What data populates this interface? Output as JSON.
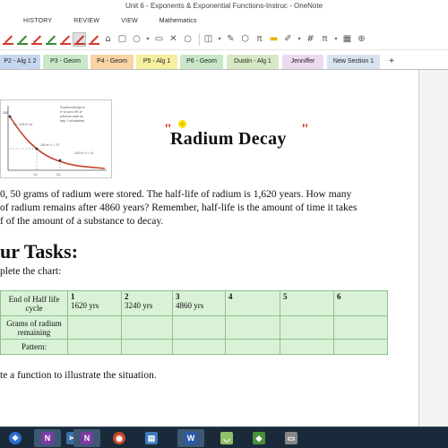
{
  "window": {
    "title": "Unit 6 - Exponents & Exponential Functions-Instruc - OneNote"
  },
  "ribbon": {
    "tabs": [
      "HISTORY",
      "REVIEW",
      "VIEW",
      "Mathematics"
    ],
    "active": "Mathematics"
  },
  "toolbar": {
    "pen_colors": [
      "#d63a2a",
      "#3a8a3a",
      "#d63a2a",
      "#3a8a3a",
      "#d63a2a",
      "#c0392b",
      "#d63a2a"
    ],
    "selected_tool_index": 5,
    "icons": [
      "lasso-icon",
      "shapes-icon",
      "eraser-icon",
      "circle-icon",
      "insert-space-icon",
      "ink-to-math-icon",
      "pi-icon",
      "highlight-icon",
      "pen-dropdown-icon",
      "grid-icon",
      "math-pi-icon",
      "table-icon",
      "more-icon"
    ],
    "glyphs": {
      "pi": "π",
      "grid": "#",
      "close": "✕",
      "plus": "+"
    }
  },
  "sections": [
    {
      "label": "P2 - Alg 1 2",
      "color": "#c8d7f0"
    },
    {
      "label": "P3 - Geom",
      "color": "#c9e8c9"
    },
    {
      "label": "P4 - Geom",
      "color": "#f7d3a6"
    },
    {
      "label": "P5 - Alg 1",
      "color": "#f5efa0"
    },
    {
      "label": "P6 - Geom",
      "color": "#c8e6c8"
    },
    {
      "label": "Dustin - Alg 1",
      "color": "#d7e8c4"
    },
    {
      "label": "Jenniffer",
      "color": "#ecd9ef"
    },
    {
      "label": "New Section 1",
      "color": "#d8e3f0"
    },
    {
      "label": "+",
      "color": "#ffffff"
    }
  ],
  "graph": {
    "annotation_1": "Function decays to",
    "annotation_2": "e^-kt as to 0% of",
    "annotation_3": "previous value as",
    "annotation_4": "step 1 not attained",
    "axis_label": "100",
    "eq_1": "N = 100 e^-kt",
    "eq_2": "100 e^-1 = 37",
    "eq_3": "100 e^-2 = 14",
    "tick_1": "1/λ",
    "tick_2": "2/λ"
  },
  "page": {
    "title": "Radium Decay",
    "quote_open": "\"",
    "quote_close": "\"",
    "star": "+",
    "paragraph": [
      "0, 50 grams of radium were stored.  The half-life of radium is 1,620 years.  How many",
      "of radium remains after 4860 years?  Remember, half-life is the amount of time it takes",
      "f of the amount of a substance to decay."
    ],
    "heading": "ur Tasks:",
    "task1": "plete the chart:",
    "task2": "te a function to illustrate the situation."
  },
  "table": {
    "row_labels": [
      "End of Half life cycle",
      "Grams of radium remaining",
      "Pattern:"
    ],
    "columns": [
      {
        "num": "1",
        "value": "1620 yrs"
      },
      {
        "num": "2",
        "value": "3240 yrs"
      },
      {
        "num": "3",
        "value": "4860 yrs"
      },
      {
        "num": "4",
        "value": ""
      },
      {
        "num": "5",
        "value": ""
      },
      {
        "num": "6",
        "value": ""
      }
    ]
  },
  "taskbar": {
    "apps": [
      {
        "name": "onenote-app",
        "icon": "N",
        "color": "#7b3aa3"
      },
      {
        "name": "scissors-app",
        "icon": "✂",
        "color": "#3b6ea5"
      },
      {
        "name": "onenote-app-2",
        "icon": "N",
        "color": "#7b3aa3"
      },
      {
        "name": "chrome-app",
        "icon": "◉",
        "color": "#c84a2a"
      },
      {
        "name": "folder-app",
        "icon": "▤",
        "color": "#3b7bbf"
      },
      {
        "name": "word-app",
        "icon": "W",
        "color": "#2a5ba8"
      },
      {
        "name": "whiteboard-app",
        "icon": "◡",
        "color": "#8fbf6a"
      },
      {
        "name": "recorder-app",
        "icon": "◆",
        "color": "#4a8f3a"
      },
      {
        "name": "gray-app",
        "icon": "▭",
        "color": "#888888"
      }
    ]
  }
}
